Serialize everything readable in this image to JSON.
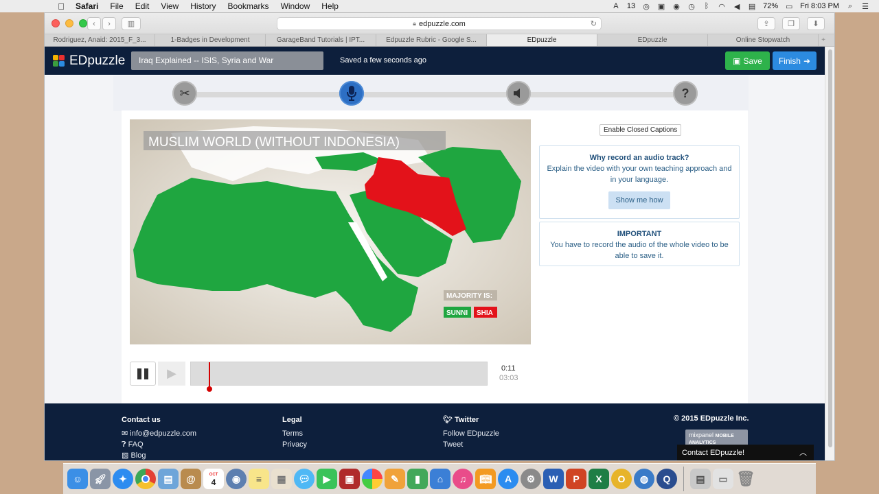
{
  "menubar": {
    "app": "Safari",
    "items": [
      "File",
      "Edit",
      "View",
      "History",
      "Bookmarks",
      "Window",
      "Help"
    ],
    "status": {
      "adobe_count": "13",
      "battery": "72%",
      "clock": "Fri 8:03 PM"
    }
  },
  "browser": {
    "url": "edpuzzle.com",
    "tabs": [
      "Rodriguez, Anaid: 2015_F_3...",
      "1-Badges in Development",
      "GarageBand Tutorials | IPT...",
      "Edpuzzle Rubric - Google S...",
      "EDpuzzle",
      "EDpuzzle",
      "Online Stopwatch"
    ],
    "active_tab_index": 4
  },
  "header": {
    "logo": "EDpuzzle",
    "video_title": "Iraq Explained -- ISIS, Syria and War",
    "saved_status": "Saved a few seconds ago",
    "save_label": "Save",
    "finish_label": "Finish"
  },
  "steps": [
    {
      "name": "cut",
      "icon": "scissors-icon",
      "active": false
    },
    {
      "name": "voiceover",
      "icon": "microphone-icon",
      "active": true
    },
    {
      "name": "audio-notes",
      "icon": "speaker-icon",
      "active": false
    },
    {
      "name": "quiz",
      "icon": "question-icon",
      "active": false
    }
  ],
  "video": {
    "banner": "MUSLIM WORLD (WITHOUT INDONESIA)",
    "legend_title": "MAJORITY IS:",
    "legend_sunni": "SUNNI",
    "legend_shia": "SHIA",
    "colors": {
      "sunni": "#1fa640",
      "shia": "#e3121a"
    }
  },
  "player": {
    "current_time": "0:11",
    "total_time": "03:03",
    "progress": 0.06
  },
  "sidebar": {
    "cc_button": "Enable Closed Captions",
    "why_title": "Why record an audio track?",
    "why_text": "Explain the video with your own teaching approach and in your language.",
    "show_me": "Show me how",
    "important_title": "IMPORTANT",
    "important_text": "You have to record the audio of the whole video to be able to save it."
  },
  "footer": {
    "contact_title": "Contact us",
    "contact_email": "info@edpuzzle.com",
    "contact_faq": "FAQ",
    "contact_blog": "Blog",
    "legal_title": "Legal",
    "legal_terms": "Terms",
    "legal_privacy": "Privacy",
    "twitter_title": "Twitter",
    "twitter_follow": "Follow EDpuzzle",
    "twitter_tweet": "Tweet",
    "copyright": "© 2015 EDpuzzle Inc.",
    "mixpanel": "mixpanel",
    "mixpanel_sub": "MOBILE ANALYTICS",
    "contact_widget": "Contact EDpuzzle!"
  },
  "dock": {
    "calendar_month": "OCT",
    "calendar_day": "4",
    "apps": [
      "finder-icon",
      "launchpad-icon",
      "safari-icon",
      "chrome-icon",
      "preview-icon",
      "contacts-icon",
      "calendar-icon",
      "quicktime-icon",
      "notes-icon",
      "photos-viewer-icon",
      "messages-icon",
      "facetime-icon",
      "photo-booth-icon",
      "photos-icon",
      "pages-icon",
      "numbers-icon",
      "keynote-icon",
      "itunes-icon",
      "ibooks-icon",
      "app-store-icon",
      "system-preferences-icon",
      "word-icon",
      "powerpoint-icon",
      "excel-icon",
      "outlook-icon",
      "network-icon",
      "quicktime-player-icon",
      "downloads-icon",
      "folder-icon",
      "trash-icon"
    ]
  }
}
